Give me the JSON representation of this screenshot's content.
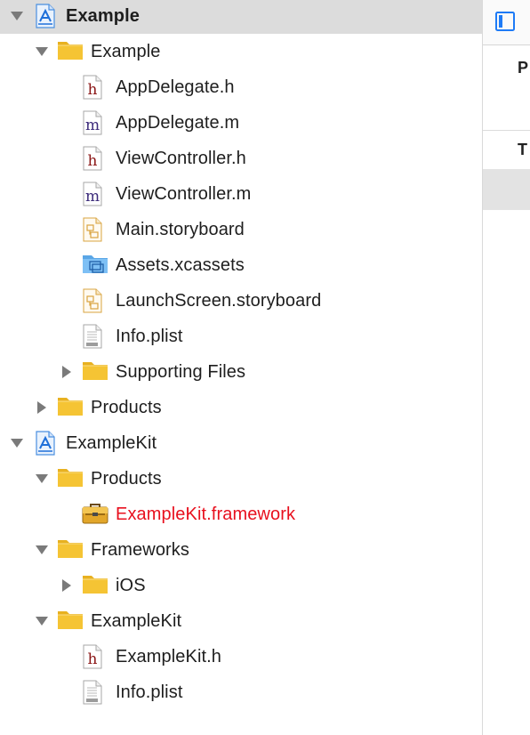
{
  "navigator": {
    "rows": [
      {
        "label": "Example",
        "icon": "xcode-project-icon",
        "disclosure": "expanded",
        "level": 0,
        "selected": true
      },
      {
        "label": "Example",
        "icon": "folder-icon",
        "disclosure": "expanded",
        "level": 1
      },
      {
        "label": "AppDelegate.h",
        "icon": "header-file-icon",
        "level": 2
      },
      {
        "label": "AppDelegate.m",
        "icon": "implementation-file-icon",
        "level": 2
      },
      {
        "label": "ViewController.h",
        "icon": "header-file-icon",
        "level": 2
      },
      {
        "label": "ViewController.m",
        "icon": "implementation-file-icon",
        "level": 2
      },
      {
        "label": "Main.storyboard",
        "icon": "storyboard-file-icon",
        "level": 2
      },
      {
        "label": "Assets.xcassets",
        "icon": "asset-catalog-icon",
        "level": 2
      },
      {
        "label": "LaunchScreen.storyboard",
        "icon": "storyboard-file-icon",
        "level": 2
      },
      {
        "label": "Info.plist",
        "icon": "plist-file-icon",
        "level": 2
      },
      {
        "label": "Supporting Files",
        "icon": "folder-icon",
        "disclosure": "collapsed",
        "level": 2
      },
      {
        "label": "Products",
        "icon": "folder-icon",
        "disclosure": "collapsed",
        "level": 1
      },
      {
        "label": "ExampleKit",
        "icon": "xcode-project-icon",
        "disclosure": "expanded",
        "level": 0
      },
      {
        "label": "Products",
        "icon": "folder-icon",
        "disclosure": "expanded",
        "level": 1
      },
      {
        "label": "ExampleKit.framework",
        "icon": "framework-toolbox-icon",
        "level": 2,
        "missing": true
      },
      {
        "label": "Frameworks",
        "icon": "folder-icon",
        "disclosure": "expanded",
        "level": 1
      },
      {
        "label": "iOS",
        "icon": "folder-icon",
        "disclosure": "collapsed",
        "level": 2
      },
      {
        "label": "ExampleKit",
        "icon": "folder-icon",
        "disclosure": "expanded",
        "level": 1
      },
      {
        "label": "ExampleKit.h",
        "icon": "header-file-icon",
        "level": 2
      },
      {
        "label": "Info.plist",
        "icon": "plist-file-icon",
        "level": 2
      }
    ]
  },
  "inspector": {
    "tab_icon": "file-inspector-icon",
    "section_1_label": "P",
    "section_2_label": "T"
  },
  "colors": {
    "selection": "#dcdcdc",
    "missing_file": "#e8101e",
    "folder": "#f5c434",
    "accent": "#1e7bf6"
  }
}
